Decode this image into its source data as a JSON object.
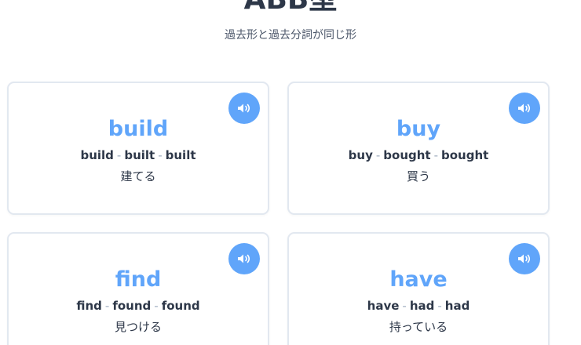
{
  "header": {
    "title": "ABB型",
    "subtitle": "過去形と過去分詞が同じ形"
  },
  "separator": "-",
  "cards": [
    {
      "word": "build",
      "base": "build",
      "past": "built",
      "participle": "built",
      "meaning": "建てる"
    },
    {
      "word": "buy",
      "base": "buy",
      "past": "bought",
      "participle": "bought",
      "meaning": "買う"
    },
    {
      "word": "find",
      "base": "find",
      "past": "found",
      "participle": "found",
      "meaning": "見つける"
    },
    {
      "word": "have",
      "base": "have",
      "past": "had",
      "participle": "had",
      "meaning": "持っている"
    }
  ],
  "colors": {
    "accent": "#60a5fa",
    "text": "#2d3748",
    "border": "#e2e8f0"
  },
  "icons": {
    "sound": "speaker-icon"
  }
}
